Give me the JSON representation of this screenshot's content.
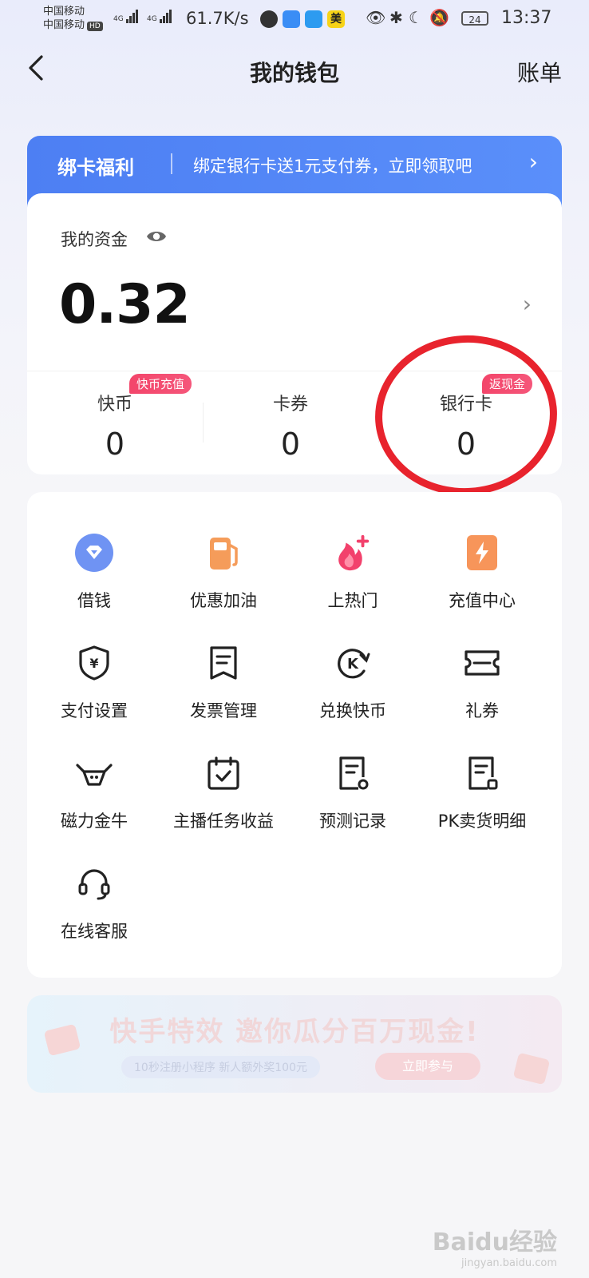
{
  "status_bar": {
    "carrier_1": "中国移动",
    "carrier_2": "中国移动",
    "hd": "HD",
    "net_type_1": "4G",
    "net_type_2": "4G",
    "net_speed": "61.7K/s",
    "app_icon_mei": "美",
    "battery": "24",
    "time": "13:37"
  },
  "nav": {
    "back_icon": "chevron-left-icon",
    "title": "我的钱包",
    "bill": "账单"
  },
  "banner": {
    "title": "绑卡福利",
    "text": "绑定银行卡送1元支付券，立即领取吧",
    "color": "#5386f6"
  },
  "funds": {
    "label": "我的资金",
    "amount": "0.32",
    "stats": [
      {
        "label": "快币",
        "value": "0",
        "badge": "快币充值"
      },
      {
        "label": "卡券",
        "value": "0"
      },
      {
        "label": "银行卡",
        "value": "0",
        "badge": "返现金"
      }
    ]
  },
  "services": [
    {
      "label": "借钱",
      "icon": "diamond-badge-icon"
    },
    {
      "label": "优惠加油",
      "icon": "gas-pump-icon"
    },
    {
      "label": "上热门",
      "icon": "fire-plus-icon"
    },
    {
      "label": "充值中心",
      "icon": "lightning-icon"
    },
    {
      "label": "支付设置",
      "icon": "yuan-shield-icon"
    },
    {
      "label": "发票管理",
      "icon": "receipt-icon"
    },
    {
      "label": "兑换快币",
      "icon": "k-coin-exchange-icon"
    },
    {
      "label": "礼券",
      "icon": "ticket-icon"
    },
    {
      "label": "磁力金牛",
      "icon": "bull-icon"
    },
    {
      "label": "主播任务收益",
      "icon": "calendar-check-icon"
    },
    {
      "label": "预测记录",
      "icon": "document-record-icon"
    },
    {
      "label": "PK卖货明细",
      "icon": "document-detail-icon"
    },
    {
      "label": "在线客服",
      "icon": "headset-icon"
    }
  ],
  "ad": {
    "title": "快手特效 邀你瓜分百万现金!",
    "subtitle": "10秒注册小程序  新人额外奖100元",
    "cta": "立即参与"
  },
  "watermark": {
    "brand": "Baidu经验",
    "url": "jingyan.baidu.com"
  },
  "colors": {
    "accent_blue": "#5386f6",
    "badge_red": "#f3456a",
    "highlight_circle": "#e8232d"
  }
}
